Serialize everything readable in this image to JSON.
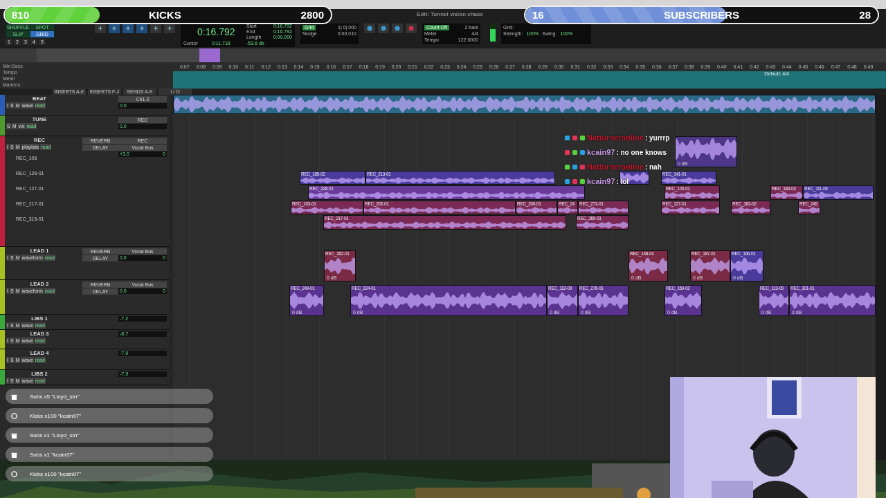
{
  "overlays": [
    {
      "kind": "kicks",
      "count": "810",
      "label": "KICKS",
      "goal": "2800",
      "level": 0.29,
      "color": "#5fd13a"
    },
    {
      "kind": "subs",
      "count": "16",
      "label": "SUBSCRIBERS",
      "goal": "28",
      "level": 0.57,
      "color": "#6f8fd8"
    }
  ],
  "window": {
    "title": "Edit: Tunnel vision chase"
  },
  "toolbar": {
    "modes": [
      {
        "label": "SHUFFLE",
        "selected": false
      },
      {
        "label": "SPOT",
        "selected": false
      },
      {
        "label": "SLIP",
        "selected": false
      },
      {
        "label": "GRID",
        "selected": true
      }
    ],
    "zoom_presets": [
      "1",
      "2",
      "3",
      "4",
      "5"
    ],
    "counter": "0:16.792",
    "selection": [
      {
        "label": "Start",
        "value": "0:16.792"
      },
      {
        "label": "End",
        "value": "0:16.792"
      },
      {
        "label": "Length",
        "value": "0:00.000"
      }
    ],
    "cursor": {
      "label": "Cursor",
      "value": "0:11.733",
      "db": "-53.6 db"
    },
    "grid": {
      "label": "Grid",
      "value": "1| 0| 000"
    },
    "nudge": {
      "label": "Nudge",
      "value": "0:00.010"
    },
    "count_off": {
      "label": "Count Off",
      "value": "2 bars"
    },
    "meter": {
      "label": "Meter",
      "value": "4/4"
    },
    "tempo": {
      "label": "Tempo",
      "value": "122.0000"
    },
    "groove": {
      "label": "Grid:",
      "strength_label": "Strength:",
      "strength": "100%",
      "swing_label": "Swing:",
      "swing": "100%"
    }
  },
  "rulers": [
    "Min:Secs",
    "Tempo",
    "Meter",
    "Markers"
  ],
  "ticks": [
    "0:07",
    "0:08",
    "0:09",
    "0:10",
    "0:11",
    "0:12",
    "0:13",
    "0:14",
    "0:15",
    "0:16",
    "0:17",
    "0:18",
    "0:19",
    "0:20",
    "0:21",
    "0:22",
    "0:23",
    "0:24",
    "0:25",
    "0:26",
    "0:27",
    "0:28",
    "0:29",
    "0:30",
    "0:31",
    "0:32",
    "0:33",
    "0:34",
    "0:35",
    "0:36",
    "0:37",
    "0:38",
    "0:39",
    "0:40",
    "0:41",
    "0:42",
    "0:43",
    "0:44",
    "0:45",
    "0:46",
    "0:47",
    "0:48",
    "0:49"
  ],
  "meter_marker": "Default: 4/4",
  "columns": [
    "INSERTS A-E",
    "INSERTS F-J",
    "SENDS A-E",
    "I / O"
  ],
  "tracks": [
    {
      "name": "BEAT",
      "color": "#2a5fb8",
      "buttons": [
        "I",
        "S",
        "M"
      ],
      "view": "wave",
      "automation": "read",
      "io": [
        "Ch1-2"
      ],
      "volume": "0.0",
      "clips": [
        {
          "color": "#2b6a86"
        }
      ]
    },
    {
      "name": "TUNE",
      "color": "#4f9a2e",
      "buttons": [
        "S",
        "M"
      ],
      "view": "vol",
      "automation": "read",
      "io": [
        "REC"
      ],
      "volume": "0.0"
    },
    {
      "name": "REC",
      "color": "#c0203f",
      "buttons": [
        "I",
        "S",
        "M"
      ],
      "view": "playlists",
      "automation": "read",
      "sends": [
        "REVERB",
        "DELAY"
      ],
      "io": [
        "REC",
        "Vocal Bus"
      ],
      "volume": "+3.0",
      "pan": "0",
      "children": [
        {
          "name": "REC_106"
        },
        {
          "name": "REC_126-01"
        },
        {
          "name": "REC_127-01"
        },
        {
          "name": "REC_217-01"
        },
        {
          "name": "REC_315-01"
        }
      ],
      "clips": [
        {
          "color": "#4d3587",
          "gain": "0 dB"
        },
        {
          "name": "REC_185-02",
          "color": "#4a3a9c"
        },
        {
          "name": "REC_213-01",
          "color": "#4a3a9c"
        },
        {
          "color": "#4a3a9c"
        },
        {
          "name": "REC_141-01",
          "color": "#4a3a9c"
        },
        {
          "name": "REC_228-01",
          "color": "#6a3a9a"
        },
        {
          "name": "REC_126-01",
          "color": "#7a2a55"
        },
        {
          "name": "REC_183-03",
          "color": "#7a2a55"
        },
        {
          "name": "REC_111-06",
          "color": "#4a3a9c"
        },
        {
          "name": "REC_103-01",
          "color": "#7a2a55"
        },
        {
          "name": "REC_202-01",
          "color": "#7a2a55"
        },
        {
          "name": "REC_200-01",
          "color": "#7a2a55"
        },
        {
          "name": "REC_24",
          "color": "#7a2a55"
        },
        {
          "name": "REC_273-01",
          "color": "#7a2a55"
        },
        {
          "name": "REC_127-01",
          "color": "#7a2a55"
        },
        {
          "name": "REC_183-02",
          "color": "#7a2a55"
        },
        {
          "name": "REC_245",
          "color": "#7a2a55"
        },
        {
          "name": "REC_217-01",
          "color": "#7a2a55"
        },
        {
          "name": "REC_269-01",
          "color": "#7a2a55"
        }
      ]
    },
    {
      "name": "LEAD 1",
      "color": "#a8c020",
      "buttons": [
        "I",
        "S",
        "M"
      ],
      "view": "waveform",
      "automation": "read",
      "sends": [
        "REVERB",
        "DELAY"
      ],
      "io": [
        "Vocal Bus"
      ],
      "volume": "0.0",
      "pan": "0",
      "clips": [
        {
          "name": "REC_262-01",
          "color": "#7a2a45",
          "gain": "0 dB"
        },
        {
          "name": "REC_148-04",
          "color": "#7a2a45",
          "gain": "0 dB"
        },
        {
          "name": "REC_187-01",
          "color": "#7a2a45",
          "gain": "0 dB"
        },
        {
          "name": "REC_166-01",
          "color": "#4a3a9c",
          "gain": "0 dB"
        }
      ]
    },
    {
      "name": "LEAD 2",
      "color": "#a8c020",
      "buttons": [
        "I",
        "S",
        "M"
      ],
      "view": "waveform",
      "automation": "read",
      "sends": [
        "REVERB",
        "DELAY"
      ],
      "io": [
        "Vocal Bus"
      ],
      "volume": "0.0",
      "pan": "0",
      "clips": [
        {
          "name": "REC_249-01",
          "color": "#5a3390",
          "gain": "0 dB"
        },
        {
          "name": "REC_224-01",
          "color": "#5a3390",
          "gain": "0 dB"
        },
        {
          "name": "REC_112-09",
          "color": "#5a3390",
          "gain": "0 dB"
        },
        {
          "name": "REC_276-01",
          "color": "#5a3390",
          "gain": "0 dB"
        },
        {
          "name": "REC_160-02",
          "color": "#5a3390",
          "gain": "0 dB"
        },
        {
          "name": "REC_113-09",
          "color": "#5a3390",
          "gain": "0 dB"
        },
        {
          "name": "REC_301-01",
          "color": "#5a3390",
          "gain": "0 dB"
        }
      ]
    },
    {
      "name": "LIBS 1",
      "color": "#3aa83a",
      "buttons": [
        "I",
        "S",
        "M"
      ],
      "view": "wave",
      "automation": "read",
      "volume": "-7.2"
    },
    {
      "name": "LEAD 3",
      "color": "#a8c020",
      "buttons": [
        "I",
        "S",
        "M"
      ],
      "view": "wave",
      "automation": "read",
      "volume": "-8.7"
    },
    {
      "name": "LEAD 4",
      "color": "#a8c020",
      "buttons": [
        "I",
        "S",
        "M"
      ],
      "view": "wave",
      "automation": "read",
      "volume": "-7.9"
    },
    {
      "name": "LIBS 2",
      "color": "#3aa83a",
      "buttons": [
        "I",
        "S",
        "M"
      ],
      "view": "wave",
      "automation": "read",
      "volume": "-7.9"
    }
  ],
  "chat": [
    {
      "user": "Natturneronline",
      "color": "#c0182e",
      "text": ": yurrrp"
    },
    {
      "user": "kcain97",
      "color": "#c79be8",
      "text": ": no one knows"
    },
    {
      "user": "Natturneronline",
      "color": "#c0182e",
      "text": ": nah"
    },
    {
      "user": "kcain97",
      "color": "#c79be8",
      "text": ": lol"
    }
  ],
  "alerts": [
    {
      "kind": "gift",
      "text": "Subs x5 \"Lloyd_strr\""
    },
    {
      "kind": "kicks",
      "text": "Kicks x100 \"kcain97\""
    },
    {
      "kind": "gift",
      "text": "Subs x1 \"Lloyd_strr\""
    },
    {
      "kind": "gift",
      "text": "Subs x1 \"kcain97\""
    },
    {
      "kind": "kicks",
      "text": "Kicks x100 \"kcain97\""
    }
  ]
}
